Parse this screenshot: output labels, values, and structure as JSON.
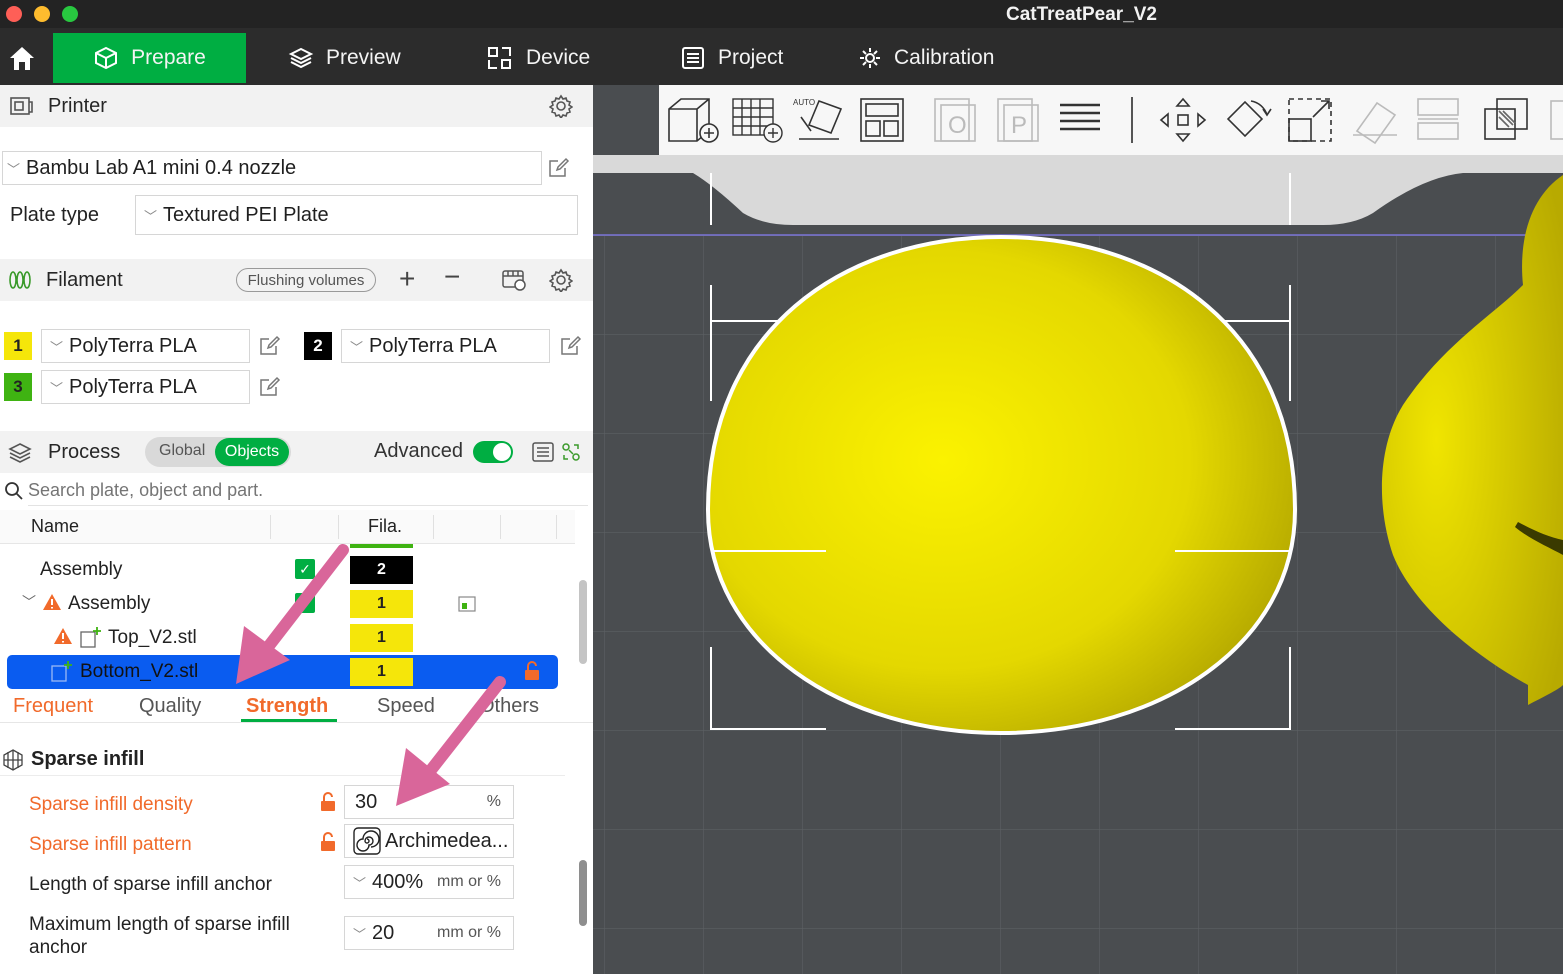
{
  "window": {
    "title": "CatTreatPear_V2"
  },
  "nav": {
    "tabs": [
      {
        "label": "Prepare",
        "icon": "cube-icon",
        "active": true
      },
      {
        "label": "Preview",
        "icon": "layers-icon"
      },
      {
        "label": "Device",
        "icon": "device-icon"
      },
      {
        "label": "Project",
        "icon": "project-icon"
      },
      {
        "label": "Calibration",
        "icon": "gear-icon"
      }
    ]
  },
  "printer": {
    "section_label": "Printer",
    "selected": "Bambu Lab A1 mini 0.4 nozzle",
    "plate_type_label": "Plate type",
    "plate_type_value": "Textured PEI Plate"
  },
  "filament": {
    "section_label": "Filament",
    "flushing_label": "Flushing volumes",
    "slots": [
      {
        "number": "1",
        "name": "PolyTerra PLA",
        "color": "#f5e60a",
        "text_color": "#222222"
      },
      {
        "number": "2",
        "name": "PolyTerra PLA",
        "color": "#000000",
        "text_color": "#ffffff"
      },
      {
        "number": "3",
        "name": "PolyTerra PLA",
        "color": "#3fb312",
        "text_color": "#222222"
      }
    ]
  },
  "process": {
    "section_label": "Process",
    "toggle_global": "Global",
    "toggle_objects": "Objects",
    "advanced_label": "Advanced",
    "advanced_on": true,
    "search_placeholder": "Search plate, object and part.",
    "columns": {
      "name": "Name",
      "fila": "Fila."
    },
    "tree": [
      {
        "label": "Assembly",
        "fila": "2",
        "level": 0,
        "warning": false,
        "checked": true,
        "fila_color": "#000000",
        "fila_text": "#ffffff"
      },
      {
        "label": "Assembly",
        "fila": "1",
        "level": 1,
        "warning": true,
        "checked": true,
        "fila_color": "#f5e60a",
        "fila_text": "#222222"
      },
      {
        "label": "Top_V2.stl",
        "fila": "1",
        "level": 2,
        "warning": true,
        "checked": false,
        "fila_color": "#f5e60a",
        "fila_text": "#222222"
      },
      {
        "label": "Bottom_V2.stl",
        "fila": "1",
        "level": 2,
        "warning": false,
        "checked": false,
        "selected": true,
        "fila_color": "#f5e60a",
        "fila_text": "#222222"
      }
    ],
    "subtabs": [
      "Frequent",
      "Quality",
      "Strength",
      "Speed",
      "Others"
    ],
    "active_subtab": "Strength"
  },
  "settings": {
    "group_title": "Sparse infill",
    "params": [
      {
        "label": "Sparse infill density",
        "value": "30",
        "unit": "%",
        "modified": true
      },
      {
        "label": "Sparse infill pattern",
        "value": "Archimedea...",
        "unit": "",
        "modified": true
      },
      {
        "label": "Length of sparse infill anchor",
        "value": "400%",
        "unit": "mm or %",
        "modified": false
      },
      {
        "label": "Maximum length of sparse infill anchor",
        "value": "20",
        "unit": "mm or %",
        "modified": false
      }
    ]
  },
  "toolbar": {
    "tools": [
      "add-object-icon",
      "add-plate-icon",
      "auto-orient-icon",
      "arrange-icon",
      "split-objects-icon",
      "split-parts-icon",
      "layers-list-icon",
      "move-icon",
      "rotate-icon",
      "scale-icon",
      "cut-icon",
      "support-paint-icon",
      "boolean-icon"
    ]
  },
  "colors": {
    "accent": "#00ae42",
    "warning_orange": "#f16a2b",
    "selection_blue": "#0a5cf0",
    "model_yellow": "#e8e000",
    "bed_grey": "#4c4f52",
    "arrow_pink": "#d9669a"
  }
}
